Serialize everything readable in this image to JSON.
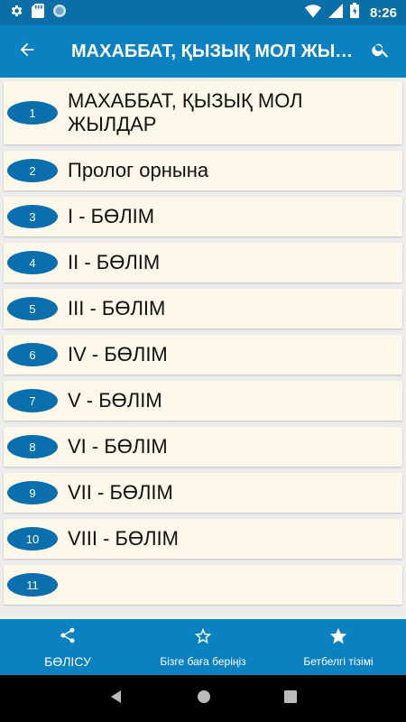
{
  "status_bar": {
    "time": "8:26",
    "left_icons": [
      "gear-icon",
      "sd-card-icon",
      "circle-icon"
    ],
    "right_icons": [
      "wifi-icon",
      "signal-icon",
      "battery-icon"
    ]
  },
  "app_bar": {
    "title": "МАХАББАТ, ҚЫЗЫҚ МОЛ ЖЫЛДАР",
    "back_icon": "arrow-left-icon",
    "search_icon": "search-icon"
  },
  "chapters": [
    {
      "num": "1",
      "label": "МАХАББАТ, ҚЫЗЫҚ МОЛ ЖЫЛДАР"
    },
    {
      "num": "2",
      "label": "Пролог орнына"
    },
    {
      "num": "3",
      "label": "I - БӨЛІМ"
    },
    {
      "num": "4",
      "label": "II - БӨЛІМ"
    },
    {
      "num": "5",
      "label": "III - БӨЛІМ"
    },
    {
      "num": "6",
      "label": "IV - БӨЛІМ"
    },
    {
      "num": "7",
      "label": "V - БӨЛІМ"
    },
    {
      "num": "8",
      "label": "VI - БӨЛІМ"
    },
    {
      "num": "9",
      "label": "VII - БӨЛІМ"
    },
    {
      "num": "10",
      "label": "VIII - БӨЛІМ"
    },
    {
      "num": "11",
      "label": ""
    }
  ],
  "bottom_nav": {
    "share": {
      "label": "БӨЛІСУ",
      "icon": "share-icon"
    },
    "rate": {
      "label": "Бізге баға беріңіз",
      "icon": "star-outline-icon"
    },
    "bookmarks": {
      "label": "Бетбелгі тізімі",
      "icon": "star-filled-icon"
    }
  },
  "system_nav": [
    "back-triangle-icon",
    "home-circle-icon",
    "recents-square-icon"
  ],
  "colors": {
    "status_bar": "#0a6fa6",
    "app_bar": "#0b81c2",
    "badge": "#0b6fae",
    "item_background": "#fdf8ea"
  }
}
